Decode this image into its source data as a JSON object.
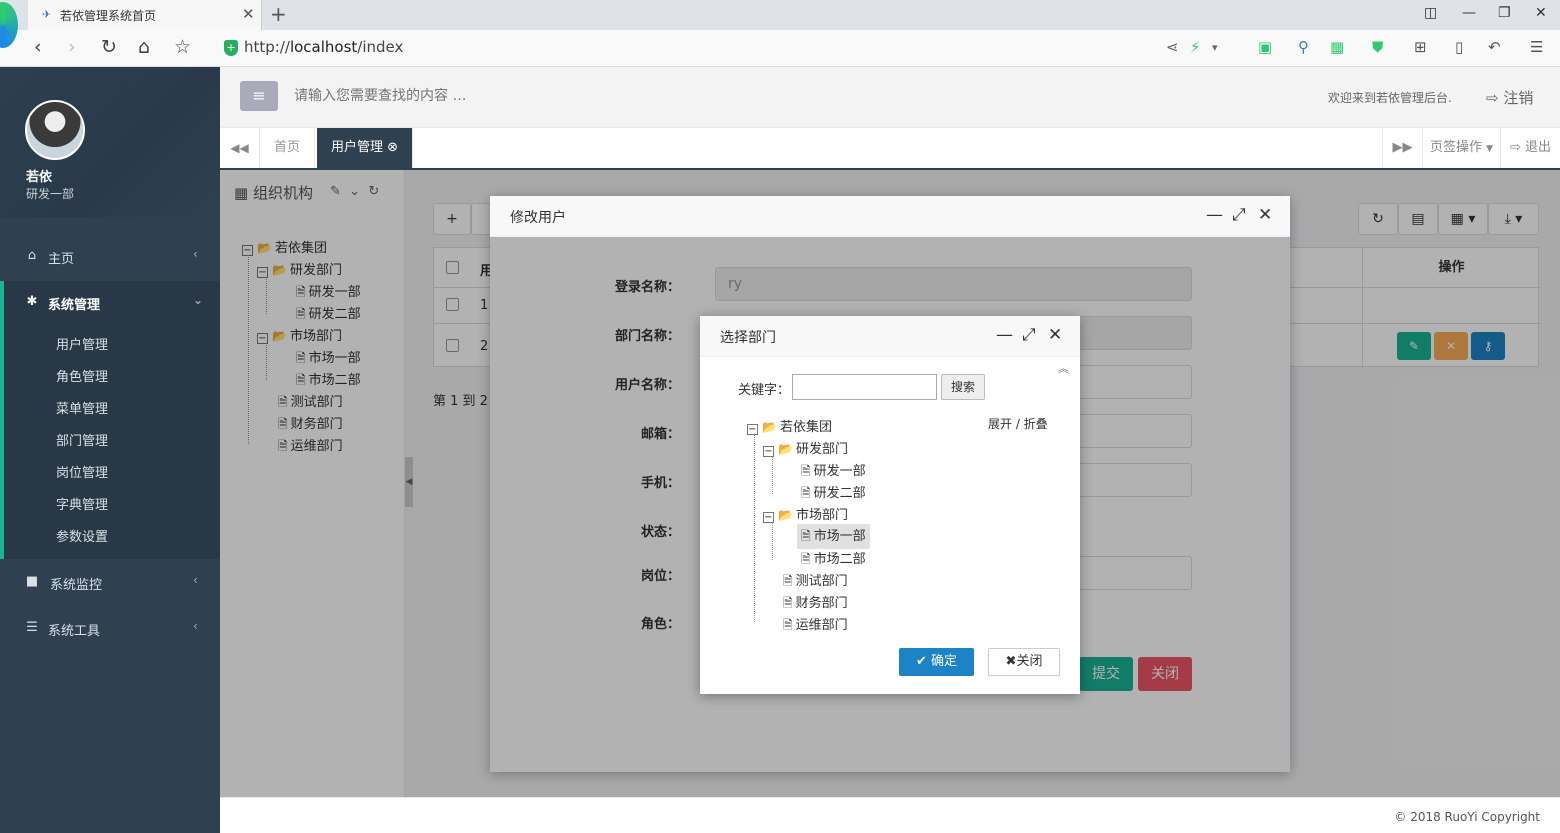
{
  "browser": {
    "tab_title": "若依管理系统首页",
    "url_prefix": "http://",
    "url_host": "localhost",
    "url_path": "/index"
  },
  "sidebar": {
    "profile_name": "若依",
    "profile_dept": "研发一部",
    "menu": [
      {
        "label": "主页",
        "icon": "home-icon"
      },
      {
        "label": "系统管理",
        "icon": "gear-icon"
      },
      {
        "label": "系统监控",
        "icon": "video-icon"
      },
      {
        "label": "系统工具",
        "icon": "bars-icon"
      }
    ],
    "submenu": [
      "用户管理",
      "角色管理",
      "菜单管理",
      "部门管理",
      "岗位管理",
      "字典管理",
      "参数设置"
    ]
  },
  "header": {
    "search_placeholder": "请输入您需要查找的内容 …",
    "welcome": "欢迎来到若依管理后台.",
    "logout": "注销"
  },
  "tabs": {
    "home": "首页",
    "user_mgmt": "用户管理",
    "page_ops": "页签操作",
    "exit": "退出"
  },
  "org_panel": {
    "title": "组织机构",
    "tree": {
      "root": "若依集团",
      "rd": "研发部门",
      "rd1": "研发一部",
      "rd2": "研发二部",
      "mkt": "市场部门",
      "mkt1": "市场一部",
      "mkt2": "市场二部",
      "test": "测试部门",
      "fin": "财务部门",
      "ops": "运维部门"
    }
  },
  "table": {
    "col_user": "用",
    "col_ops": "操作",
    "row1_no": "1",
    "row2_no": "2",
    "pager": "第 1 到 2"
  },
  "edit_dialog": {
    "title": "修改用户",
    "login_name_label": "登录名称：",
    "login_name_value": "ry",
    "dept_label": "部门名称：",
    "user_name_label": "用户名称：",
    "email_label": "邮箱：",
    "phone_label": "手机：",
    "status_label": "状态：",
    "post_label": "岗位：",
    "role_label": "角色：",
    "submit": "提交",
    "close": "关闭"
  },
  "dept_dialog": {
    "title": "选择部门",
    "keyword_label": "关键字：",
    "search_btn": "搜索",
    "expand_toggle": "展开 / 折叠",
    "ok": "确定",
    "close": "关闭"
  },
  "footer": {
    "copyright": "© 2018 RuoYi Copyright"
  },
  "colors": {
    "sidebar_bg": "#2f4050",
    "accent": "#1ab394",
    "primary": "#1c84c6",
    "warning": "#f8ac59",
    "danger": "#ed5565"
  }
}
